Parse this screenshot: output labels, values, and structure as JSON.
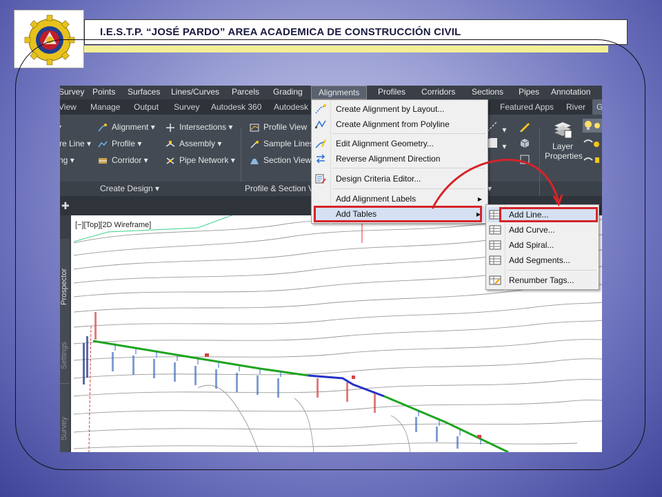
{
  "slide": {
    "title": "I.E.S.T.P. “JOSÉ PARDO” AREA ACADEMICA DE CONSTRUCCIÓN CIVIL",
    "colors": {
      "accent_red": "#d6242a",
      "highlight_yellow": "#f3ef95",
      "ribbon": "#434a54"
    }
  },
  "menubar": {
    "items": [
      "Survey",
      "Points",
      "Surfaces",
      "Lines/Curves",
      "Parcels",
      "Grading",
      "Alignments",
      "Profiles",
      "Corridors",
      "Sections",
      "Pipes",
      "Annotation"
    ],
    "active": "Alignments"
  },
  "ribbon_tabs": {
    "items": [
      "View",
      "Manage",
      "Output",
      "Survey",
      "Autodesk 360",
      "Autodesk",
      "Featured Apps",
      "River",
      "G"
    ]
  },
  "ribbon": {
    "create_design": {
      "title": "Create Design",
      "items": [
        "Alignment",
        "Intersections",
        "re Line",
        "Profile",
        "Assembly",
        "ng",
        "Corridor",
        "Pipe Network"
      ]
    },
    "profile_section": {
      "title": "Profile & Section V",
      "items": [
        "Profile View",
        "Sample Lines",
        "Section Views"
      ]
    },
    "layer_properties": "Layer\nProperties"
  },
  "left_palette": {
    "tabs": [
      "Prospector",
      "Settings",
      "Survey"
    ]
  },
  "viewport_label": "[−][Top][2D Wireframe]",
  "alignments_menu": {
    "items": [
      {
        "label": "Create Alignment by Layout...",
        "icon": "alignment-layout-icon"
      },
      {
        "label": "Create Alignment from Polyline",
        "icon": "alignment-polyline-icon"
      },
      {
        "label": "Edit Alignment Geometry...",
        "icon": "edit-geometry-icon"
      },
      {
        "label": "Reverse Alignment Direction",
        "icon": "reverse-direction-icon"
      },
      {
        "label": "Design Criteria Editor...",
        "icon": "design-criteria-icon"
      },
      {
        "label": "Add Alignment Labels",
        "submenu": true
      },
      {
        "label": "Add Tables",
        "submenu": true,
        "highlighted": true
      }
    ]
  },
  "tables_submenu": {
    "items": [
      {
        "label": "Add Line...",
        "icon": "table-icon",
        "highlighted": true
      },
      {
        "label": "Add Curve...",
        "icon": "table-icon"
      },
      {
        "label": "Add Spiral...",
        "icon": "table-icon"
      },
      {
        "label": "Add Segments...",
        "icon": "table-icon"
      },
      {
        "label": "Renumber Tags...",
        "icon": "renumber-tags-icon"
      }
    ]
  }
}
